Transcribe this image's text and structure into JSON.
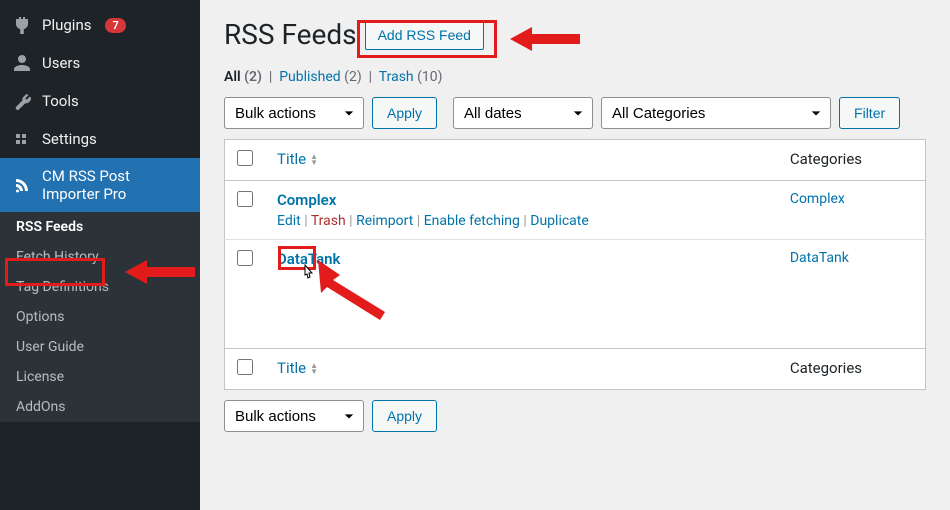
{
  "sidebar": {
    "top_items": [
      {
        "name": "plugins",
        "label": "Plugins",
        "badge": "7"
      },
      {
        "name": "users",
        "label": "Users"
      },
      {
        "name": "tools",
        "label": "Tools"
      },
      {
        "name": "settings",
        "label": "Settings"
      }
    ],
    "active": {
      "name": "cm-rss",
      "label": "CM RSS Post Importer Pro"
    },
    "submenu": [
      {
        "name": "rss-feeds",
        "label": "RSS Feeds",
        "current": true
      },
      {
        "name": "fetch-history",
        "label": "Fetch History"
      },
      {
        "name": "tag-definitions",
        "label": "Tag Definitions"
      },
      {
        "name": "options",
        "label": "Options"
      },
      {
        "name": "user-guide",
        "label": "User Guide"
      },
      {
        "name": "license",
        "label": "License"
      },
      {
        "name": "addons",
        "label": "AddOns"
      }
    ]
  },
  "page": {
    "title": "RSS Feeds",
    "add_button": "Add RSS Feed",
    "views": {
      "all": {
        "label": "All",
        "count": "(2)"
      },
      "published": {
        "label": "Published",
        "count": "(2)"
      },
      "trash": {
        "label": "Trash",
        "count": "(10)"
      }
    },
    "bulk_action_label": "Bulk actions",
    "apply_label": "Apply",
    "dates_label": "All dates",
    "categories_filter_label": "All Categories",
    "filter_label": "Filter",
    "columns": {
      "title": "Title",
      "categories": "Categories"
    },
    "row_actions": {
      "edit": "Edit",
      "trash": "Trash",
      "reimport": "Reimport",
      "enable_fetching": "Enable fetching",
      "duplicate": "Duplicate"
    },
    "rows": [
      {
        "title": "Complex",
        "category": "Complex",
        "show_actions": true
      },
      {
        "title": "DataTank",
        "category": "DataTank",
        "show_actions": false
      }
    ]
  }
}
